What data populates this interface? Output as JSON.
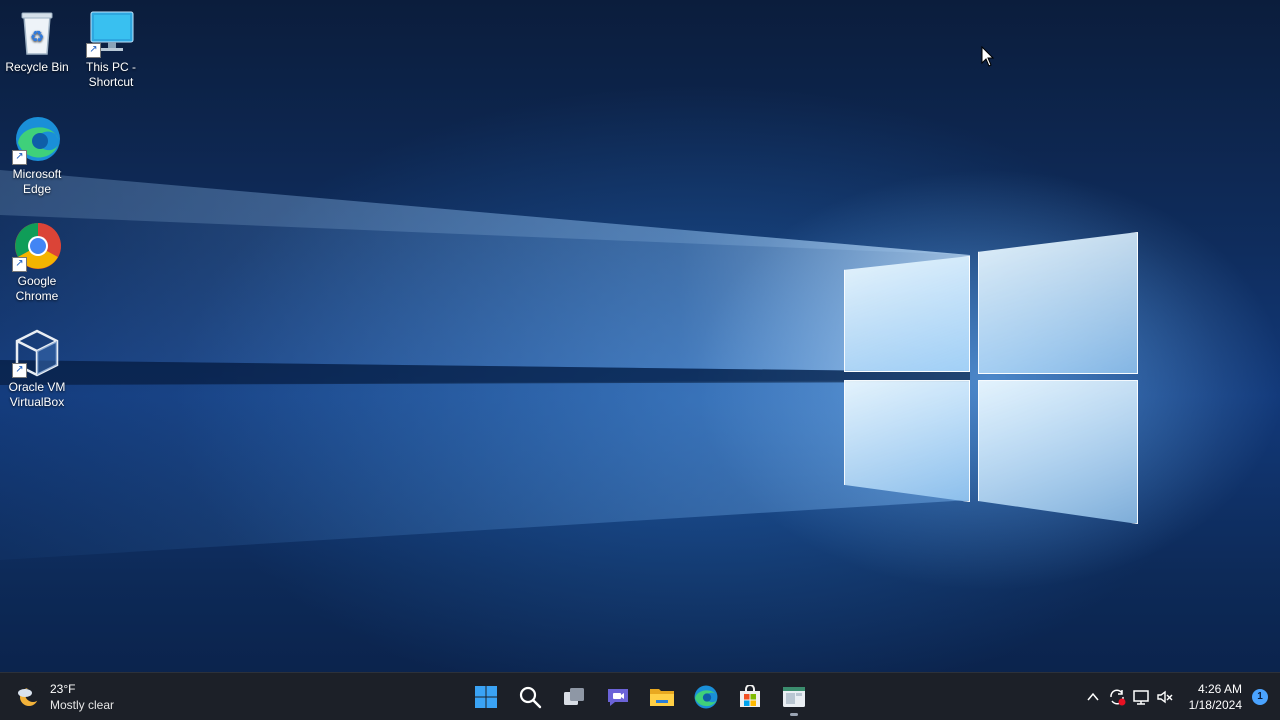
{
  "desktop": {
    "icons": [
      {
        "label": "Recycle Bin",
        "icon": "recycle-bin-icon",
        "shortcut": false
      },
      {
        "label": "This PC - Shortcut",
        "icon": "this-pc-icon",
        "shortcut": true
      },
      {
        "label": "Microsoft Edge",
        "icon": "edge-icon",
        "shortcut": true
      },
      {
        "label": "Google Chrome",
        "icon": "chrome-icon",
        "shortcut": true
      },
      {
        "label": "Oracle VM VirtualBox",
        "icon": "virtualbox-icon",
        "shortcut": true
      }
    ]
  },
  "taskbar": {
    "weather": {
      "temp": "23°F",
      "condition": "Mostly clear",
      "icon": "moon-cloud-icon"
    },
    "pinned": [
      {
        "name": "start",
        "icon": "windows-logo-icon"
      },
      {
        "name": "search",
        "icon": "search-icon"
      },
      {
        "name": "task-view",
        "icon": "task-view-icon"
      },
      {
        "name": "teams-chat",
        "icon": "teams-chat-icon"
      },
      {
        "name": "file-explorer",
        "icon": "folder-icon"
      },
      {
        "name": "edge",
        "icon": "edge-icon"
      },
      {
        "name": "microsoft-store",
        "icon": "store-icon"
      },
      {
        "name": "open-window",
        "icon": "app-window-icon",
        "running": true
      }
    ],
    "tray": {
      "icons": [
        "chevron-up-icon",
        "sync-icon",
        "network-icon",
        "volume-muted-icon"
      ],
      "time": "4:26 AM",
      "date": "1/18/2024",
      "notification_count": "1"
    }
  },
  "colors": {
    "taskbar_bg": "#1c2028",
    "accent": "#4aa3ff"
  }
}
